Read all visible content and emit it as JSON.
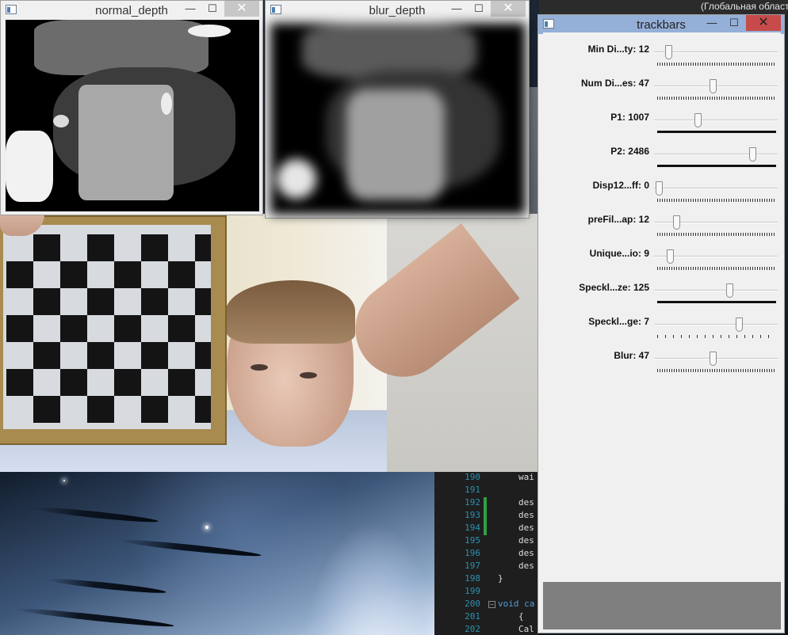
{
  "windows": {
    "normal_depth": {
      "title": "normal_depth"
    },
    "blur_depth": {
      "title": "blur_depth"
    },
    "trackbars": {
      "title": "trackbars"
    }
  },
  "window_buttons": {
    "minimize": "—",
    "maximize": "☐",
    "close": "✕"
  },
  "taskbar": {
    "text": "(Глобальная област"
  },
  "trackbars": [
    {
      "label": "Min Di...ty: 12",
      "level": 0.08
    },
    {
      "label": "Num Di...es: 47",
      "level": 0.47
    },
    {
      "label": "P1: 1007",
      "level": 0.34
    },
    {
      "label": "P2: 2486",
      "level": 0.82
    },
    {
      "label": "Disp12...ff: 0",
      "level": 0.0
    },
    {
      "label": "preFil...ap: 12",
      "level": 0.15
    },
    {
      "label": "Unique...io: 9",
      "level": 0.1
    },
    {
      "label": "Speckl...ze: 125",
      "level": 0.62
    },
    {
      "label": "Speckl...ge: 7",
      "level": 0.7
    },
    {
      "label": "Blur: 47",
      "level": 0.47
    }
  ],
  "code": {
    "lines": [
      {
        "no": "190",
        "text": "wai"
      },
      {
        "no": "191",
        "text": ""
      },
      {
        "no": "192",
        "text": "des"
      },
      {
        "no": "193",
        "text": "des"
      },
      {
        "no": "194",
        "text": "des"
      },
      {
        "no": "195",
        "text": "des"
      },
      {
        "no": "196",
        "text": "des"
      },
      {
        "no": "197",
        "text": "des"
      },
      {
        "no": "198",
        "text": "}"
      },
      {
        "no": "199",
        "text": ""
      },
      {
        "no": "200",
        "text": "void ca"
      },
      {
        "no": "201",
        "text": "{"
      },
      {
        "no": "202",
        "text": "Cal"
      }
    ]
  }
}
